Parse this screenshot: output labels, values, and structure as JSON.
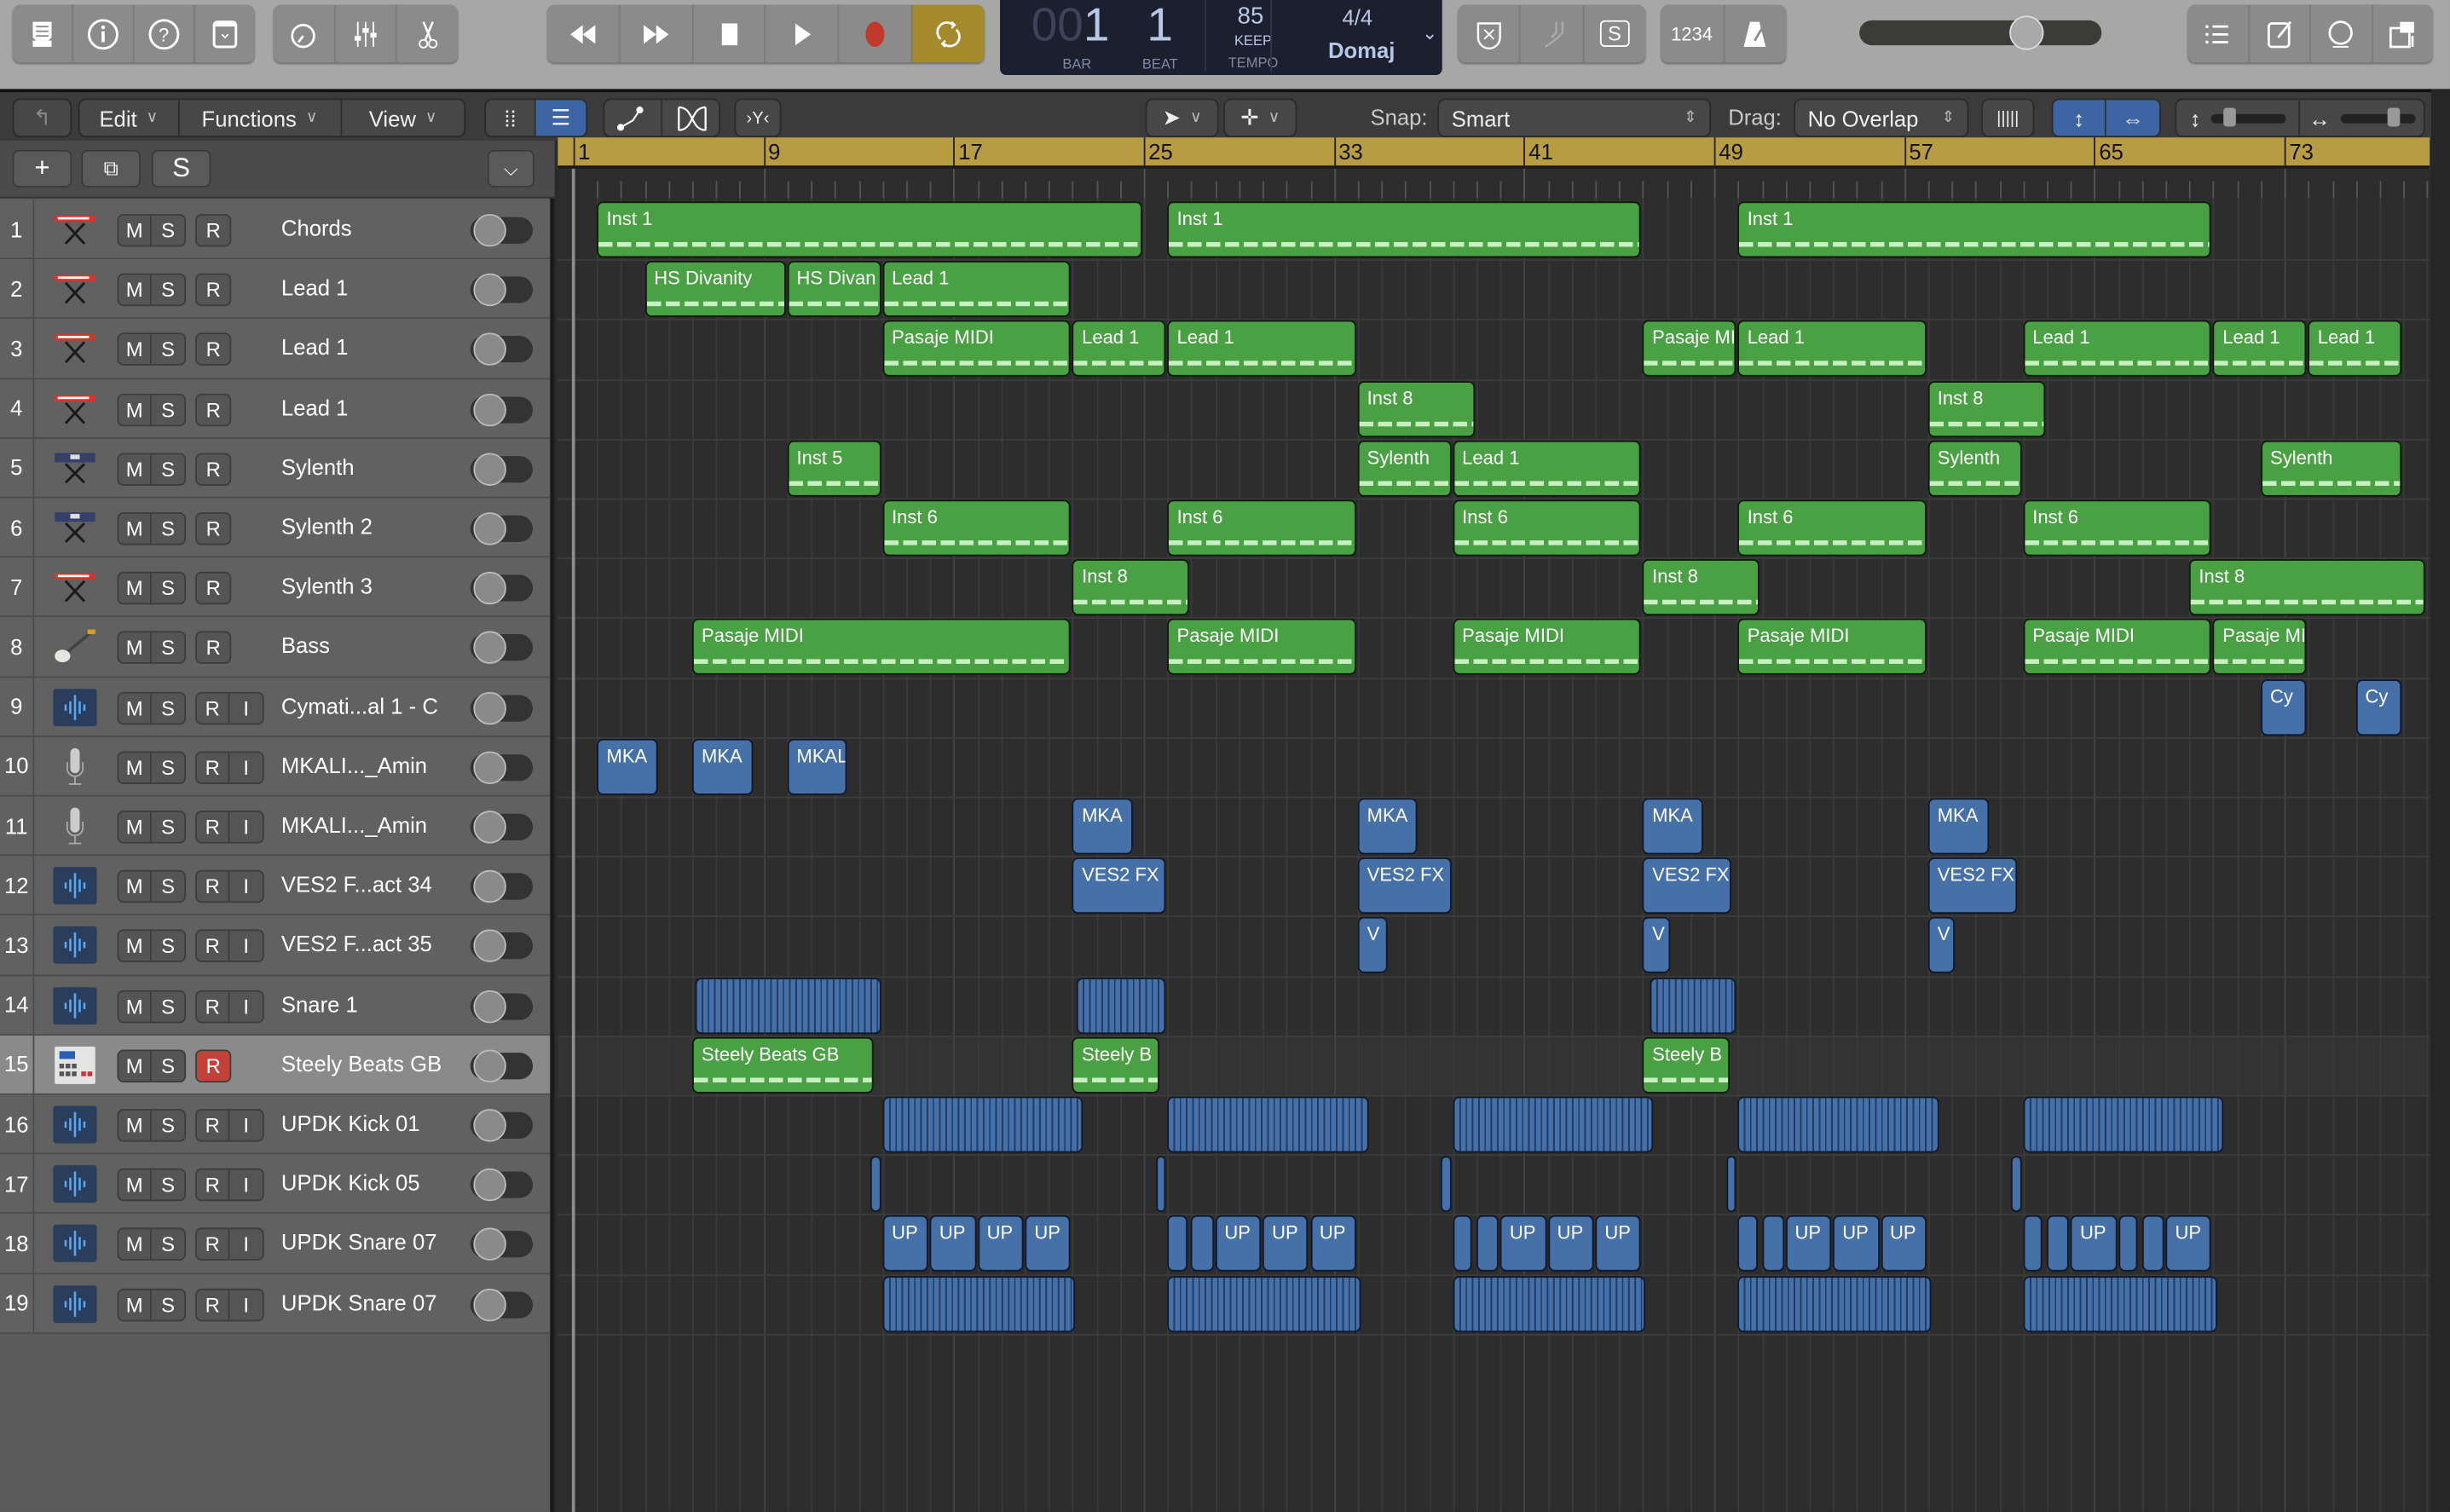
{
  "control_bar": {
    "view_buttons": [
      {
        "name": "library"
      },
      {
        "name": "inspector"
      },
      {
        "name": "quick-help"
      },
      {
        "name": "toolbar"
      }
    ],
    "tool_buttons": [
      {
        "name": "smart-controls"
      },
      {
        "name": "mixer"
      },
      {
        "name": "editors"
      }
    ],
    "transport": [
      {
        "name": "rewind"
      },
      {
        "name": "fast-forward"
      },
      {
        "name": "stop"
      },
      {
        "name": "play"
      },
      {
        "name": "record"
      },
      {
        "name": "cycle",
        "active": true
      }
    ],
    "lcd": {
      "bar_prefix": "00",
      "bar": "1",
      "beat": "1",
      "bar_label": "BAR",
      "beat_label": "BEAT",
      "tempo": "85",
      "tempo_mode": "KEEP",
      "tempo_label": "TEMPO",
      "signature": "4/4",
      "key": "Domaj"
    },
    "mode_buttons": [
      {
        "name": "replace"
      },
      {
        "name": "tuner"
      },
      {
        "name": "solo",
        "label": "S"
      }
    ],
    "count_in": "1234",
    "master_volume": 0.62,
    "right_buttons": [
      {
        "name": "list-editors"
      },
      {
        "name": "note-pad"
      },
      {
        "name": "loop-browser"
      },
      {
        "name": "media-browser"
      }
    ],
    "colors": {
      "cycle": "#a58a2c",
      "record": "#c0392b"
    }
  },
  "arrange_bar": {
    "menus": [
      "Edit",
      "Functions",
      "View"
    ],
    "snap_label": "Snap:",
    "snap_value": "Smart",
    "drag_label": "Drag:",
    "drag_value": "No Overlap"
  },
  "track_header_bar": {
    "solo_label": "S"
  },
  "ruler": {
    "labels": [
      "1",
      "9",
      "17",
      "25",
      "33",
      "41",
      "49",
      "57",
      "65",
      "73"
    ],
    "first_bar": 1,
    "step": 8,
    "visible_bars": 79
  },
  "tracks": [
    {
      "n": "1",
      "name": "Chords",
      "icon": "synth-red",
      "input": false,
      "armed": false
    },
    {
      "n": "2",
      "name": "Lead 1",
      "icon": "synth-red",
      "input": false,
      "armed": false
    },
    {
      "n": "3",
      "name": "Lead 1",
      "icon": "synth-red",
      "input": false,
      "armed": false
    },
    {
      "n": "4",
      "name": "Lead 1",
      "icon": "synth-red",
      "input": false,
      "armed": false
    },
    {
      "n": "5",
      "name": "Sylenth",
      "icon": "synth-blue",
      "input": false,
      "armed": false
    },
    {
      "n": "6",
      "name": "Sylenth 2",
      "icon": "synth-blue",
      "input": false,
      "armed": false
    },
    {
      "n": "7",
      "name": "Sylenth 3",
      "icon": "synth-red",
      "input": false,
      "armed": false
    },
    {
      "n": "8",
      "name": "Bass",
      "icon": "bass",
      "input": false,
      "armed": false
    },
    {
      "n": "9",
      "name": "Cymati...al 1 - C",
      "icon": "audio",
      "input": true,
      "armed": false
    },
    {
      "n": "10",
      "name": "MKALI..._Amin",
      "icon": "mic",
      "input": true,
      "armed": false
    },
    {
      "n": "11",
      "name": "MKALI..._Amin",
      "icon": "mic",
      "input": true,
      "armed": false
    },
    {
      "n": "12",
      "name": "VES2 F...act 34",
      "icon": "audio",
      "input": true,
      "armed": false
    },
    {
      "n": "13",
      "name": "VES2 F...act 35",
      "icon": "audio",
      "input": true,
      "armed": false
    },
    {
      "n": "14",
      "name": "Snare 1",
      "icon": "audio",
      "input": true,
      "armed": false
    },
    {
      "n": "15",
      "name": "Steely Beats GB",
      "icon": "drum-machine",
      "input": false,
      "armed": true,
      "selected": true
    },
    {
      "n": "16",
      "name": "UPDK Kick 01",
      "icon": "audio",
      "input": true,
      "armed": false
    },
    {
      "n": "17",
      "name": "UPDK Kick 05",
      "icon": "audio",
      "input": true,
      "armed": false
    },
    {
      "n": "18",
      "name": "UPDK Snare 07",
      "icon": "audio",
      "input": true,
      "armed": false
    },
    {
      "n": "19",
      "name": "UPDK Snare 07",
      "icon": "audio",
      "input": true,
      "armed": false
    }
  ],
  "button_labels": {
    "mute": "M",
    "solo": "S",
    "record": "R",
    "input": "I"
  },
  "regions": [
    {
      "t": 1,
      "s": 2,
      "e": 25,
      "label": "Inst 1",
      "type": "midi"
    },
    {
      "t": 1,
      "s": 26,
      "e": 46,
      "label": "Inst 1",
      "type": "midi"
    },
    {
      "t": 1,
      "s": 50,
      "e": 70,
      "label": "Inst 1",
      "type": "midi"
    },
    {
      "t": 2,
      "s": 4,
      "e": 10,
      "label": "HS Divanity",
      "type": "midi"
    },
    {
      "t": 2,
      "s": 10,
      "e": 14,
      "label": "HS Divan",
      "type": "midi"
    },
    {
      "t": 2,
      "s": 14,
      "e": 22,
      "label": "Lead 1",
      "type": "midi"
    },
    {
      "t": 3,
      "s": 14,
      "e": 22,
      "label": "Pasaje MIDI",
      "type": "midi"
    },
    {
      "t": 3,
      "s": 22,
      "e": 26,
      "label": "Lead 1",
      "type": "midi"
    },
    {
      "t": 3,
      "s": 26,
      "e": 34,
      "label": "Lead 1",
      "type": "midi"
    },
    {
      "t": 3,
      "s": 46,
      "e": 50,
      "label": "Pasaje MI",
      "type": "midi"
    },
    {
      "t": 3,
      "s": 50,
      "e": 58,
      "label": "Lead 1",
      "type": "midi"
    },
    {
      "t": 3,
      "s": 62,
      "e": 70,
      "label": "Lead 1",
      "type": "midi"
    },
    {
      "t": 3,
      "s": 70,
      "e": 74,
      "label": "Lead 1",
      "type": "midi"
    },
    {
      "t": 3,
      "s": 74,
      "e": 78,
      "label": "Lead 1",
      "type": "midi"
    },
    {
      "t": 4,
      "s": 34,
      "e": 39,
      "label": "Inst 8",
      "type": "midi"
    },
    {
      "t": 4,
      "s": 58,
      "e": 63,
      "label": "Inst 8",
      "type": "midi"
    },
    {
      "t": 5,
      "s": 10,
      "e": 14,
      "label": "Inst 5",
      "type": "midi"
    },
    {
      "t": 5,
      "s": 34,
      "e": 38,
      "label": "Sylenth",
      "type": "midi"
    },
    {
      "t": 5,
      "s": 38,
      "e": 46,
      "label": "Lead 1",
      "type": "midi"
    },
    {
      "t": 5,
      "s": 58,
      "e": 62,
      "label": "Sylenth",
      "type": "midi"
    },
    {
      "t": 5,
      "s": 72,
      "e": 78,
      "label": "Sylenth",
      "type": "midi"
    },
    {
      "t": 6,
      "s": 14,
      "e": 22,
      "label": "Inst 6",
      "type": "midi"
    },
    {
      "t": 6,
      "s": 26,
      "e": 34,
      "label": "Inst 6",
      "type": "midi"
    },
    {
      "t": 6,
      "s": 38,
      "e": 46,
      "label": "Inst 6",
      "type": "midi"
    },
    {
      "t": 6,
      "s": 50,
      "e": 58,
      "label": "Inst 6",
      "type": "midi"
    },
    {
      "t": 6,
      "s": 62,
      "e": 70,
      "label": "Inst 6",
      "type": "midi"
    },
    {
      "t": 7,
      "s": 22,
      "e": 27,
      "label": "Inst 8",
      "type": "midi"
    },
    {
      "t": 7,
      "s": 46,
      "e": 51,
      "label": "Inst 8",
      "type": "midi"
    },
    {
      "t": 7,
      "s": 69,
      "e": 79,
      "label": "Inst 8",
      "type": "midi"
    },
    {
      "t": 8,
      "s": 6,
      "e": 22,
      "label": "Pasaje MIDI",
      "type": "midi"
    },
    {
      "t": 8,
      "s": 26,
      "e": 34,
      "label": "Pasaje MIDI",
      "type": "midi"
    },
    {
      "t": 8,
      "s": 38,
      "e": 46,
      "label": "Pasaje MIDI",
      "type": "midi"
    },
    {
      "t": 8,
      "s": 50,
      "e": 58,
      "label": "Pasaje MIDI",
      "type": "midi"
    },
    {
      "t": 8,
      "s": 62,
      "e": 70,
      "label": "Pasaje MIDI",
      "type": "midi"
    },
    {
      "t": 8,
      "s": 70,
      "e": 74,
      "label": "Pasaje MI",
      "type": "midi"
    },
    {
      "t": 9,
      "s": 72,
      "e": 74,
      "label": "Cy",
      "type": "audio"
    },
    {
      "t": 9,
      "s": 76,
      "e": 78,
      "label": "Cy",
      "type": "audio"
    },
    {
      "t": 10,
      "s": 2,
      "e": 4.6,
      "label": "MKA",
      "type": "audio"
    },
    {
      "t": 10,
      "s": 6,
      "e": 8.6,
      "label": "MKA",
      "type": "audio"
    },
    {
      "t": 10,
      "s": 10,
      "e": 12.6,
      "label": "MKAL",
      "type": "audio"
    },
    {
      "t": 11,
      "s": 22,
      "e": 24.6,
      "label": "MKA",
      "type": "audio"
    },
    {
      "t": 11,
      "s": 34,
      "e": 36.6,
      "label": "MKA",
      "type": "audio"
    },
    {
      "t": 11,
      "s": 46,
      "e": 48.6,
      "label": "MKA",
      "type": "audio"
    },
    {
      "t": 11,
      "s": 58,
      "e": 60.6,
      "label": "MKA",
      "type": "audio"
    },
    {
      "t": 12,
      "s": 22,
      "e": 26,
      "label": "VES2 FX",
      "type": "audio"
    },
    {
      "t": 12,
      "s": 34,
      "e": 38,
      "label": "VES2 FX",
      "type": "audio"
    },
    {
      "t": 12,
      "s": 46,
      "e": 49.8,
      "label": "VES2 FX",
      "type": "audio"
    },
    {
      "t": 12,
      "s": 58,
      "e": 61.8,
      "label": "VES2 FX",
      "type": "audio"
    },
    {
      "t": 13,
      "s": 34,
      "e": 35.3,
      "label": "V",
      "type": "audio"
    },
    {
      "t": 13,
      "s": 46,
      "e": 47.2,
      "label": "V",
      "type": "audio"
    },
    {
      "t": 13,
      "s": 58,
      "e": 59.2,
      "label": "V",
      "type": "audio"
    },
    {
      "t": 14,
      "s": 6.1,
      "e": 14,
      "label": "",
      "type": "lines"
    },
    {
      "t": 14,
      "s": 22.2,
      "e": 26,
      "label": "",
      "type": "lines"
    },
    {
      "t": 14,
      "s": 46.3,
      "e": 50,
      "label": "",
      "type": "lines"
    },
    {
      "t": 15,
      "s": 6,
      "e": 13.7,
      "label": "Steely Beats GB",
      "type": "midi"
    },
    {
      "t": 15,
      "s": 22,
      "e": 25.7,
      "label": "Steely B",
      "type": "midi"
    },
    {
      "t": 15,
      "s": 46,
      "e": 49.7,
      "label": "Steely B",
      "type": "midi"
    },
    {
      "t": 16,
      "s": 14,
      "e": 22.5,
      "label": "",
      "type": "lines"
    },
    {
      "t": 16,
      "s": 26,
      "e": 34.5,
      "label": "",
      "type": "lines"
    },
    {
      "t": 16,
      "s": 38,
      "e": 46.5,
      "label": "",
      "type": "lines"
    },
    {
      "t": 16,
      "s": 50,
      "e": 58.5,
      "label": "",
      "type": "lines"
    },
    {
      "t": 16,
      "s": 62,
      "e": 70.5,
      "label": "",
      "type": "lines"
    },
    {
      "t": 17,
      "s": 13.5,
      "e": 14,
      "label": "",
      "type": "audio"
    },
    {
      "t": 17,
      "s": 25.5,
      "e": 26,
      "label": "",
      "type": "audio"
    },
    {
      "t": 17,
      "s": 37.5,
      "e": 38,
      "label": "",
      "type": "audio"
    },
    {
      "t": 17,
      "s": 49.5,
      "e": 50,
      "label": "",
      "type": "audio"
    },
    {
      "t": 17,
      "s": 61.5,
      "e": 62,
      "label": "",
      "type": "audio"
    },
    {
      "t": 18,
      "s": 14,
      "e": 16,
      "label": "UP",
      "type": "audio"
    },
    {
      "t": 18,
      "s": 16,
      "e": 18,
      "label": "UP",
      "type": "audio"
    },
    {
      "t": 18,
      "s": 18,
      "e": 20,
      "label": "UP",
      "type": "audio"
    },
    {
      "t": 18,
      "s": 20,
      "e": 22,
      "label": "UP",
      "type": "audio"
    },
    {
      "t": 18,
      "s": 26,
      "e": 26.9,
      "label": "",
      "type": "audio"
    },
    {
      "t": 18,
      "s": 27,
      "e": 28,
      "label": "",
      "type": "audio"
    },
    {
      "t": 18,
      "s": 28,
      "e": 30,
      "label": "UP",
      "type": "audio"
    },
    {
      "t": 18,
      "s": 30,
      "e": 32,
      "label": "UP",
      "type": "audio"
    },
    {
      "t": 18,
      "s": 32,
      "e": 34,
      "label": "UP",
      "type": "audio"
    },
    {
      "t": 18,
      "s": 38,
      "e": 38.9,
      "label": "",
      "type": "audio"
    },
    {
      "t": 18,
      "s": 39,
      "e": 40,
      "label": "",
      "type": "audio"
    },
    {
      "t": 18,
      "s": 40,
      "e": 42,
      "label": "UP",
      "type": "audio"
    },
    {
      "t": 18,
      "s": 42,
      "e": 44,
      "label": "UP",
      "type": "audio"
    },
    {
      "t": 18,
      "s": 44,
      "e": 46,
      "label": "UP",
      "type": "audio"
    },
    {
      "t": 18,
      "s": 50,
      "e": 50.9,
      "label": "",
      "type": "audio"
    },
    {
      "t": 18,
      "s": 51,
      "e": 52,
      "label": "",
      "type": "audio"
    },
    {
      "t": 18,
      "s": 52,
      "e": 54,
      "label": "UP",
      "type": "audio"
    },
    {
      "t": 18,
      "s": 54,
      "e": 56,
      "label": "UP",
      "type": "audio"
    },
    {
      "t": 18,
      "s": 56,
      "e": 58,
      "label": "UP",
      "type": "audio"
    },
    {
      "t": 18,
      "s": 62,
      "e": 62.9,
      "label": "",
      "type": "audio"
    },
    {
      "t": 18,
      "s": 63,
      "e": 64,
      "label": "",
      "type": "audio"
    },
    {
      "t": 18,
      "s": 64,
      "e": 66,
      "label": "UP",
      "type": "audio"
    },
    {
      "t": 18,
      "s": 66,
      "e": 66.9,
      "label": "",
      "type": "audio"
    },
    {
      "t": 18,
      "s": 67,
      "e": 68,
      "label": "",
      "type": "audio"
    },
    {
      "t": 18,
      "s": 68,
      "e": 70,
      "label": "UP",
      "type": "audio"
    },
    {
      "t": 19,
      "s": 14,
      "e": 22.2,
      "label": "",
      "type": "lines"
    },
    {
      "t": 19,
      "s": 26,
      "e": 34.2,
      "label": "",
      "type": "lines"
    },
    {
      "t": 19,
      "s": 38,
      "e": 46.2,
      "label": "",
      "type": "lines"
    },
    {
      "t": 19,
      "s": 50,
      "e": 58.2,
      "label": "",
      "type": "lines"
    },
    {
      "t": 19,
      "s": 62,
      "e": 70.2,
      "label": "",
      "type": "lines"
    }
  ]
}
